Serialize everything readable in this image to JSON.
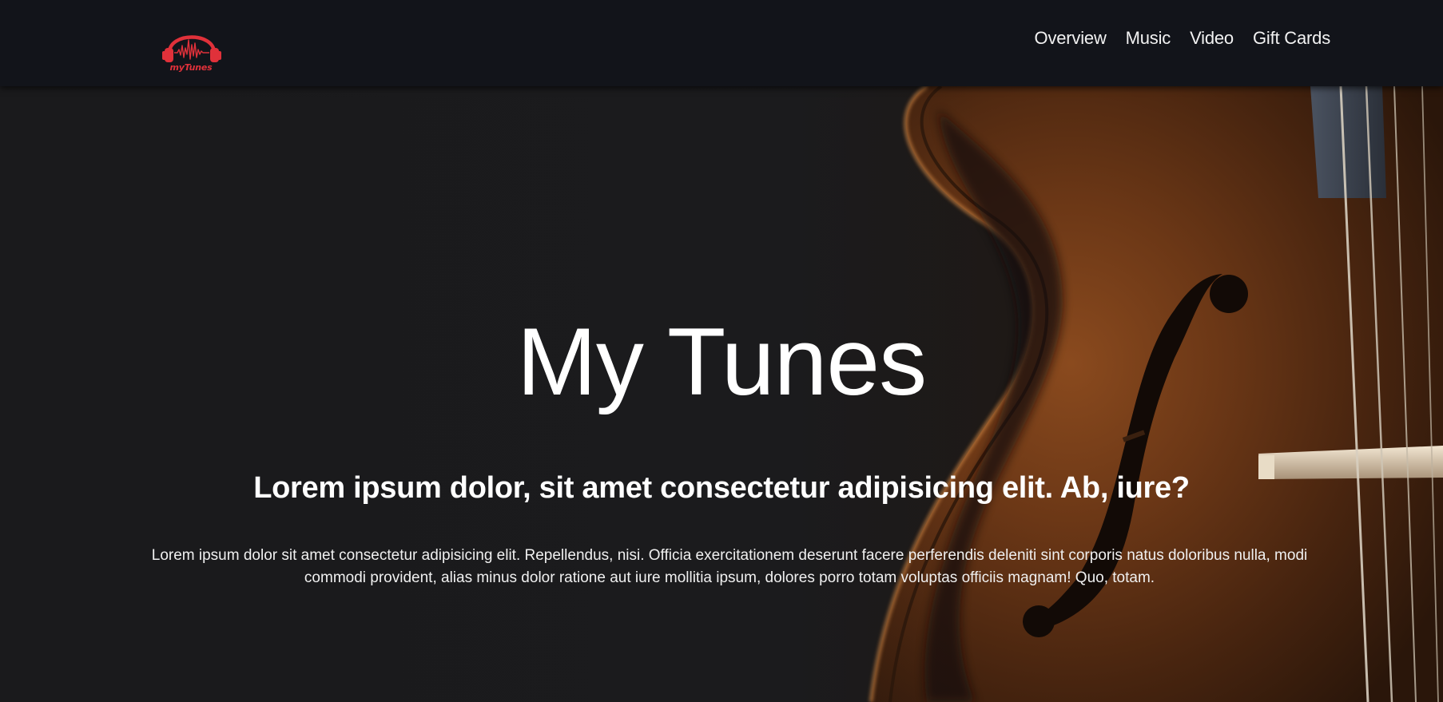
{
  "navbar": {
    "logo_text": "myTunes",
    "links": [
      {
        "label": "Overview"
      },
      {
        "label": "Music"
      },
      {
        "label": "Video"
      },
      {
        "label": "Gift Cards"
      }
    ]
  },
  "hero": {
    "title": "My Tunes",
    "subtitle": "Lorem ipsum dolor, sit amet consectetur adipisicing elit. Ab, iure?",
    "body": "Lorem ipsum dolor sit amet consectetur adipisicing elit. Repellendus, nisi. Officia exercitationem deserunt facere perferendis deleniti sint corporis natus doloribus nulla, modi commodi provident, alias minus dolor ratione aut iure mollitia ipsum, dolores porro totam voluptas officiis magnam! Quo, totam.",
    "background_image": "violin-photo"
  },
  "colors": {
    "navbar_bg": "#12141a",
    "brand_red": "#e0313a",
    "hero_dark": "#1a1a1c",
    "text": "#ffffff"
  }
}
